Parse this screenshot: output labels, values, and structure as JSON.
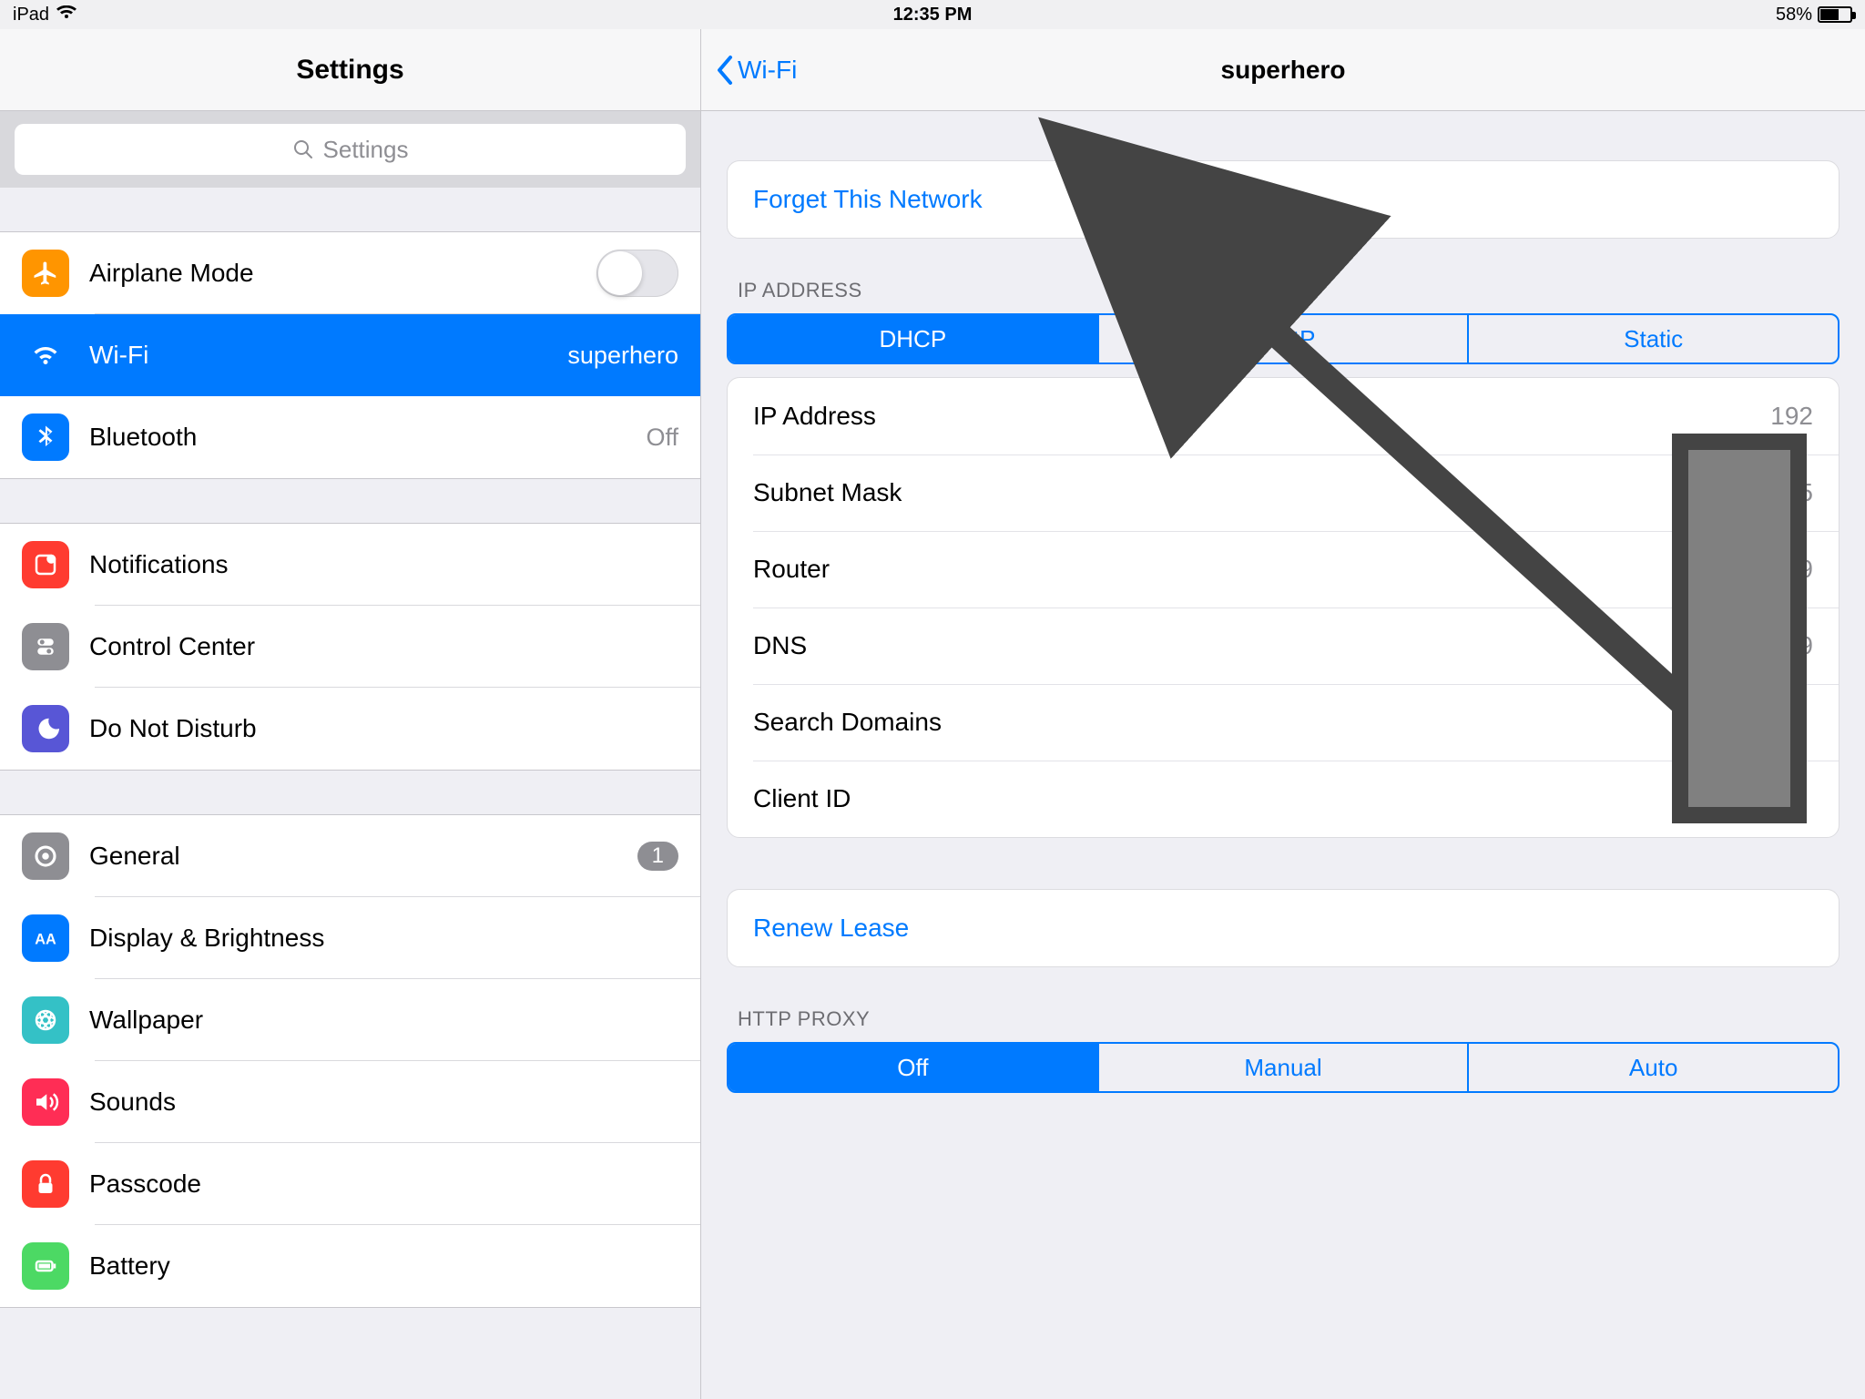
{
  "status": {
    "device": "iPad",
    "time": "12:35 PM",
    "battery_pct": "58%"
  },
  "sidebar": {
    "title": "Settings",
    "search_placeholder": "Settings",
    "airplane": "Airplane Mode",
    "wifi": "Wi-Fi",
    "wifi_value": "superhero",
    "bluetooth": "Bluetooth",
    "bluetooth_value": "Off",
    "notifications": "Notifications",
    "control_center": "Control Center",
    "dnd": "Do Not Disturb",
    "general": "General",
    "general_badge": "1",
    "display": "Display & Brightness",
    "wallpaper": "Wallpaper",
    "sounds": "Sounds",
    "passcode": "Passcode",
    "battery": "Battery"
  },
  "detail": {
    "back_label": "Wi-Fi",
    "title": "superhero",
    "forget": "Forget This Network",
    "ip_section": "IP ADDRESS",
    "seg_ip": {
      "dhcp": "DHCP",
      "bootp": "BootP",
      "static": "Static"
    },
    "fields": {
      "ip_label": "IP Address",
      "ip_value": "192",
      "subnet_label": "Subnet Mask",
      "subnet_value": "255.25",
      "router_label": "Router",
      "router_value": "19",
      "dns_label": "DNS",
      "dns_value": "19",
      "search_label": "Search Domains",
      "search_value": "",
      "client_label": "Client ID",
      "client_value": ""
    },
    "renew": "Renew Lease",
    "proxy_section": "HTTP PROXY",
    "seg_proxy": {
      "off": "Off",
      "manual": "Manual",
      "auto": "Auto"
    }
  }
}
